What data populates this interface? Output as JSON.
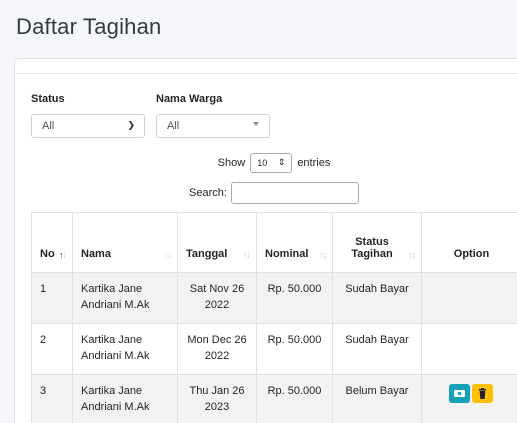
{
  "page": {
    "title": "Daftar Tagihan"
  },
  "filters": {
    "status_label": "Status",
    "status_value": "All",
    "warga_label": "Nama Warga",
    "warga_value": "All"
  },
  "datatable": {
    "show_label": "Show",
    "length_value": "10",
    "entries_label": "entries",
    "search_label": "Search:",
    "search_value": ""
  },
  "table": {
    "headers": [
      "No",
      "Nama",
      "Tanggal",
      "Nominal",
      "Status Tagihan",
      "Option"
    ],
    "rows": [
      {
        "no": "1",
        "nama": "Kartika Jane Andriani M.Ak",
        "tanggal": "Sat Nov 26 2022",
        "nominal": "Rp. 50.000",
        "status": "Sudah Bayar",
        "actions": []
      },
      {
        "no": "2",
        "nama": "Kartika Jane Andriani M.Ak",
        "tanggal": "Mon Dec 26 2022",
        "nominal": "Rp. 50.000",
        "status": "Sudah Bayar",
        "actions": []
      },
      {
        "no": "3",
        "nama": "Kartika Jane Andriani M.Ak",
        "tanggal": "Thu Jan 26 2023",
        "nominal": "Rp. 50.000",
        "status": "Belum Bayar",
        "actions": [
          "pay-icon",
          "trash-icon"
        ]
      }
    ]
  },
  "colors": {
    "info": "#17a2b8",
    "warning": "#ffc107"
  }
}
